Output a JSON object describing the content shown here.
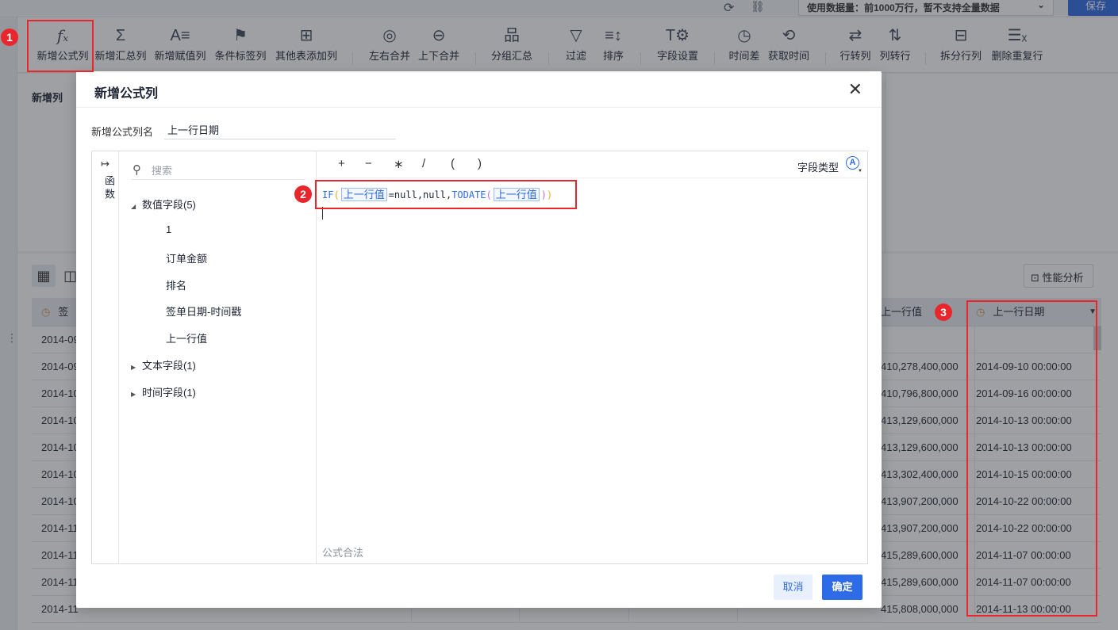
{
  "topbar": {
    "data_selector": "使用数据量：前1000万行，暂不支持全量数据",
    "save_label": "保存"
  },
  "toolbar": {
    "items": [
      {
        "label": "新增公式列",
        "icon": "fx-icon"
      },
      {
        "label": "新增汇总列",
        "icon": "sigma-icon"
      },
      {
        "label": "新增赋值列",
        "icon": "assign-icon"
      },
      {
        "label": "条件标签列",
        "icon": "flag-icon"
      },
      {
        "label": "其他表添加列",
        "icon": "add-column-icon"
      },
      {
        "label": "左右合并",
        "icon": "merge-horizontal-icon"
      },
      {
        "label": "上下合并",
        "icon": "merge-vertical-icon"
      },
      {
        "label": "分组汇总",
        "icon": "group-icon"
      },
      {
        "label": "过滤",
        "icon": "filter-icon"
      },
      {
        "label": "排序",
        "icon": "sort-icon"
      },
      {
        "label": "字段设置",
        "icon": "field-settings-icon"
      },
      {
        "label": "时间差",
        "icon": "time-diff-icon"
      },
      {
        "label": "获取时间",
        "icon": "get-time-icon"
      },
      {
        "label": "行转列",
        "icon": "row-to-col-icon"
      },
      {
        "label": "列转行",
        "icon": "col-to-row-icon"
      },
      {
        "label": "拆分行列",
        "icon": "split-icon"
      },
      {
        "label": "删除重复行",
        "icon": "dedupe-icon"
      }
    ]
  },
  "panel": {
    "new_column_label": "新增列",
    "perf_label": "性能分析"
  },
  "table": {
    "header_left": "签",
    "header_prev_value": "上一行值",
    "header_prev_date": "上一行日期",
    "rows": [
      {
        "date": "2014-09",
        "value": "",
        "prev_date": ""
      },
      {
        "date": "2014-09",
        "value": "410,278,400,000",
        "prev_date": "2014-09-10 00:00:00"
      },
      {
        "date": "2014-10",
        "value": "410,796,800,000",
        "prev_date": "2014-09-16 00:00:00"
      },
      {
        "date": "2014-10",
        "value": "413,129,600,000",
        "prev_date": "2014-10-13 00:00:00"
      },
      {
        "date": "2014-10",
        "value": "413,129,600,000",
        "prev_date": "2014-10-13 00:00:00"
      },
      {
        "date": "2014-10",
        "value": "413,302,400,000",
        "prev_date": "2014-10-15 00:00:00"
      },
      {
        "date": "2014-10",
        "value": "413,907,200,000",
        "prev_date": "2014-10-22 00:00:00"
      },
      {
        "date": "2014-11",
        "value": "413,907,200,000",
        "prev_date": "2014-10-22 00:00:00"
      },
      {
        "date": "2014-11",
        "value": "415,289,600,000",
        "prev_date": "2014-11-07 00:00:00"
      },
      {
        "date": "2014-11",
        "value": "415,289,600,000",
        "prev_date": "2014-11-07 00:00:00"
      },
      {
        "date": "2014-11",
        "value": "415,808,000,000",
        "prev_date": "2014-11-13 00:00:00"
      }
    ]
  },
  "dialog": {
    "title": "新增公式列",
    "name_label": "新增公式列名",
    "name_value": "上一行日期",
    "side_label": "函数",
    "search_placeholder": "搜索",
    "tree": {
      "numeric_group": "数值字段(5)",
      "numeric_fields": [
        "1",
        "订单金额",
        "排名",
        "签单日期-时间戳",
        "上一行值"
      ],
      "text_group": "文本字段(1)",
      "time_group": "时间字段(1)"
    },
    "operators": [
      "+",
      "−",
      "∗",
      "/",
      "(",
      ")"
    ],
    "field_type_label": "字段类型",
    "field_type_icon": "A",
    "formula": {
      "fn1": "IF",
      "open1": "(",
      "field1": "上一行值",
      "mid": "=null,null,",
      "fn2": "TODATE",
      "open2": "(",
      "field2": "上一行值",
      "close2": ")",
      "close1": ")"
    },
    "status_text": "公式合法",
    "cancel_label": "取消",
    "ok_label": "确定"
  },
  "annotations": {
    "badge1": "1",
    "badge2": "2",
    "badge3": "3"
  },
  "colors": {
    "accent": "#2e6be6",
    "annotation_red": "#e8262b"
  }
}
